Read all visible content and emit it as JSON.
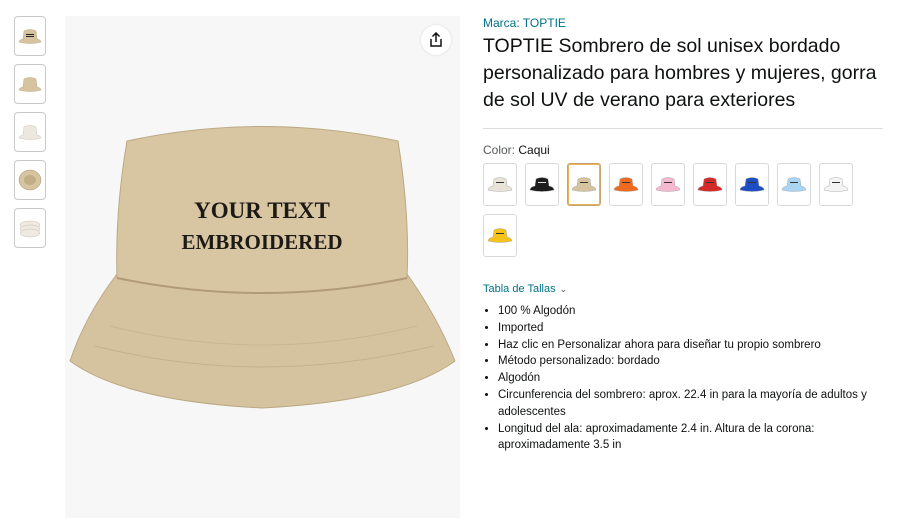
{
  "product": {
    "brand_label": "Marca: TOPTIE",
    "title": "TOPTIE Sombrero de sol unisex bordado personalizado para hombres y mujeres, gorra de sol UV de verano para exteriores",
    "embroidery_line1": "YOUR TEXT",
    "embroidery_line2": "EMBROIDERED"
  },
  "color": {
    "label": "Color:",
    "selected": "Caqui",
    "swatches": [
      {
        "name": "beige-claro",
        "hex": "#e8e3d6"
      },
      {
        "name": "negro",
        "hex": "#1d1d1d"
      },
      {
        "name": "caqui",
        "hex": "#d6c4a0"
      },
      {
        "name": "naranja",
        "hex": "#ee6a1f"
      },
      {
        "name": "rosa",
        "hex": "#f5b8cf"
      },
      {
        "name": "rojo",
        "hex": "#d42a2a"
      },
      {
        "name": "azul",
        "hex": "#1e4fc2"
      },
      {
        "name": "azul-claro",
        "hex": "#a9d5f2"
      },
      {
        "name": "blanco",
        "hex": "#f4f4f4"
      },
      {
        "name": "amarillo",
        "hex": "#f6c21c"
      }
    ]
  },
  "size_chart": {
    "label": "Tabla de Tallas"
  },
  "bullets": [
    "100 % Algodón",
    "Imported",
    "Haz clic en Personalizar ahora para diseñar tu propio sombrero",
    "Método personalizado: bordado",
    "Algodón",
    "Circunferencia del sombrero: aprox. 22.4 in para la mayoría de adultos y adolescentes",
    "Longitud del ala: aproximadamente 2.4 in. Altura de la corona: aproximadamente 3.5 in"
  ],
  "colors": {
    "hat_khaki": "#d6c4a0",
    "link": "#007185"
  }
}
